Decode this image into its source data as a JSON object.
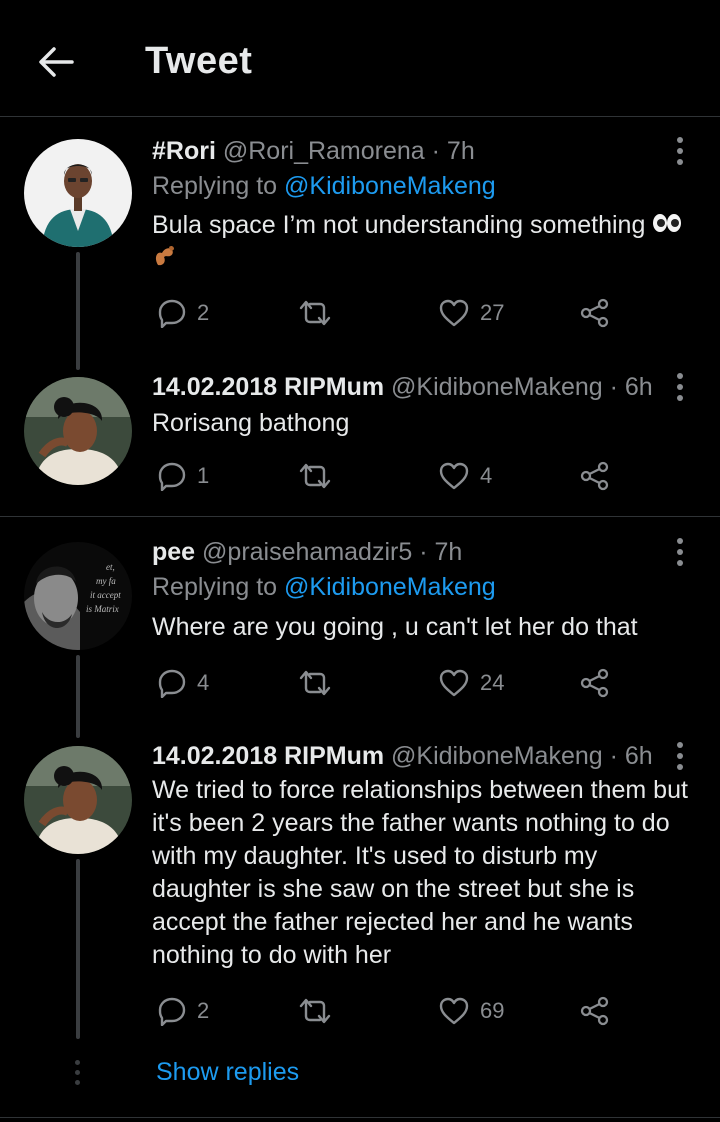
{
  "header": {
    "title": "Tweet"
  },
  "tweets": [
    {
      "name": "#Rori",
      "handle": "@Rori_Ramorena",
      "time": "· 7h",
      "replying_prefix": "Replying to",
      "replying_to": "@KidiboneMakeng",
      "text": "Bula space I’m not understanding something",
      "replies": "2",
      "retweets": "",
      "likes": "27"
    },
    {
      "name": "14.02.2018 RIPMum",
      "handle": "@KidiboneMakeng",
      "time": "· 6h",
      "text": "Rorisang bathong",
      "replies": "1",
      "retweets": "",
      "likes": "4"
    },
    {
      "name": "pee",
      "handle": "@praisehamadzir5",
      "time": "· 7h",
      "replying_prefix": "Replying to",
      "replying_to": "@KidiboneMakeng",
      "text": "Where are you going , u can't let her do that",
      "replies": "4",
      "retweets": "",
      "likes": "24"
    },
    {
      "name": "14.02.2018 RIPMum",
      "handle": "@KidiboneMakeng",
      "time": "· 6h",
      "text_lines": [
        "We tried to force relationships between them but",
        "it's been 2 years the father wants nothing to do",
        "with my daughter. It's used to disturb my",
        "daughter is she saw on the street but she is",
        "accept the father rejected her and he wants",
        "nothing to do with her"
      ],
      "replies": "2",
      "retweets": "",
      "likes": "69"
    }
  ],
  "show_replies": "Show replies",
  "avatar_3_text": [
    "et,",
    "my fa",
    "it accept",
    "is Matrix"
  ],
  "colors": {
    "background": "#000000",
    "accent": "#1d9bf0",
    "muted": "#8a8d91",
    "text": "#e7e9ea"
  }
}
